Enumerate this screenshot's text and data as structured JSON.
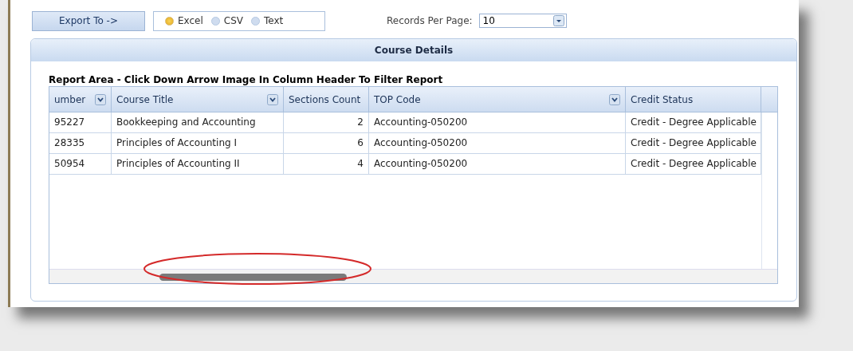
{
  "toolbar": {
    "export_button": "Export To ->",
    "formats": [
      {
        "label": "Excel",
        "selected": true
      },
      {
        "label": "CSV",
        "selected": false
      },
      {
        "label": "Text",
        "selected": false
      }
    ],
    "records_label": "Records Per Page:",
    "records_value": "10"
  },
  "panel": {
    "title": "Course Details",
    "instructions": "Report Area - Click Down Arrow Image In Column Header To Filter Report",
    "table": {
      "columns": [
        {
          "label": "umber",
          "filterable": true
        },
        {
          "label": "Course Title",
          "filterable": true
        },
        {
          "label": "Sections Count",
          "filterable": false
        },
        {
          "label": "TOP Code",
          "filterable": true
        },
        {
          "label": "Credit Status",
          "filterable": false
        }
      ],
      "rows": [
        [
          "95227",
          "Bookkeeping and Accounting",
          "2",
          "Accounting-050200",
          "Credit - Degree Applicable"
        ],
        [
          "28335",
          "Principles of Accounting I",
          "6",
          "Accounting-050200",
          "Credit - Degree Applicable"
        ],
        [
          "50954",
          "Principles of Accounting II",
          "4",
          "Accounting-050200",
          "Credit - Degree Applicable"
        ]
      ]
    }
  }
}
